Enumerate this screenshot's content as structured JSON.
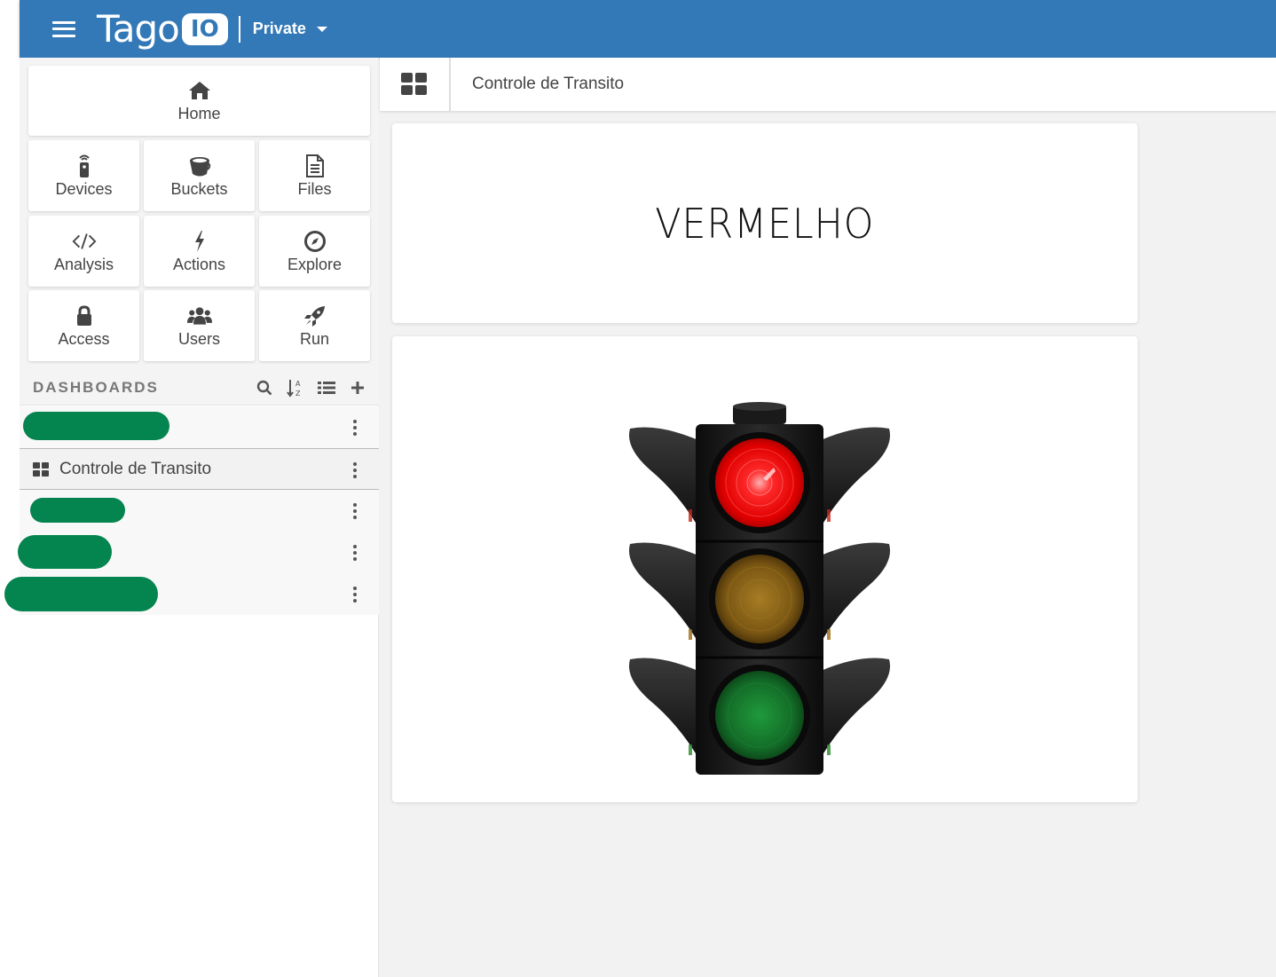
{
  "topbar": {
    "menu_icon": "hamburger-icon",
    "logo_text": "Tago",
    "logo_badge": "IO",
    "profile": "Private",
    "colors": {
      "background": "#3479b7"
    }
  },
  "sidebar": {
    "nav": [
      {
        "label": "Home",
        "icon": "home-icon"
      },
      {
        "label": "Devices",
        "icon": "device-icon"
      },
      {
        "label": "Buckets",
        "icon": "bucket-icon"
      },
      {
        "label": "Files",
        "icon": "file-icon"
      },
      {
        "label": "Analysis",
        "icon": "code-icon"
      },
      {
        "label": "Actions",
        "icon": "bolt-icon"
      },
      {
        "label": "Explore",
        "icon": "compass-icon"
      },
      {
        "label": "Access",
        "icon": "lock-icon"
      },
      {
        "label": "Users",
        "icon": "users-icon"
      },
      {
        "label": "Run",
        "icon": "rocket-icon"
      }
    ],
    "dashboards": {
      "title": "DASHBOARDS",
      "tools": [
        "search-icon",
        "sort-alpha-icon",
        "list-icon",
        "plus-icon"
      ],
      "items": [
        {
          "label": "",
          "redacted": true
        },
        {
          "label": "Controle de Transito",
          "active": true
        },
        {
          "label": "",
          "redacted": true
        },
        {
          "label": "",
          "redacted": true
        },
        {
          "label": "",
          "redacted": true
        }
      ],
      "redaction_color": "#04844f"
    }
  },
  "main": {
    "header": {
      "dashboard_name": "Controle de Transito",
      "icon": "dashboard-grid-icon"
    },
    "widgets": [
      {
        "type": "display",
        "value": "VERMELHO"
      },
      {
        "type": "image",
        "content": "traffic-light",
        "active_light": "red"
      }
    ]
  }
}
